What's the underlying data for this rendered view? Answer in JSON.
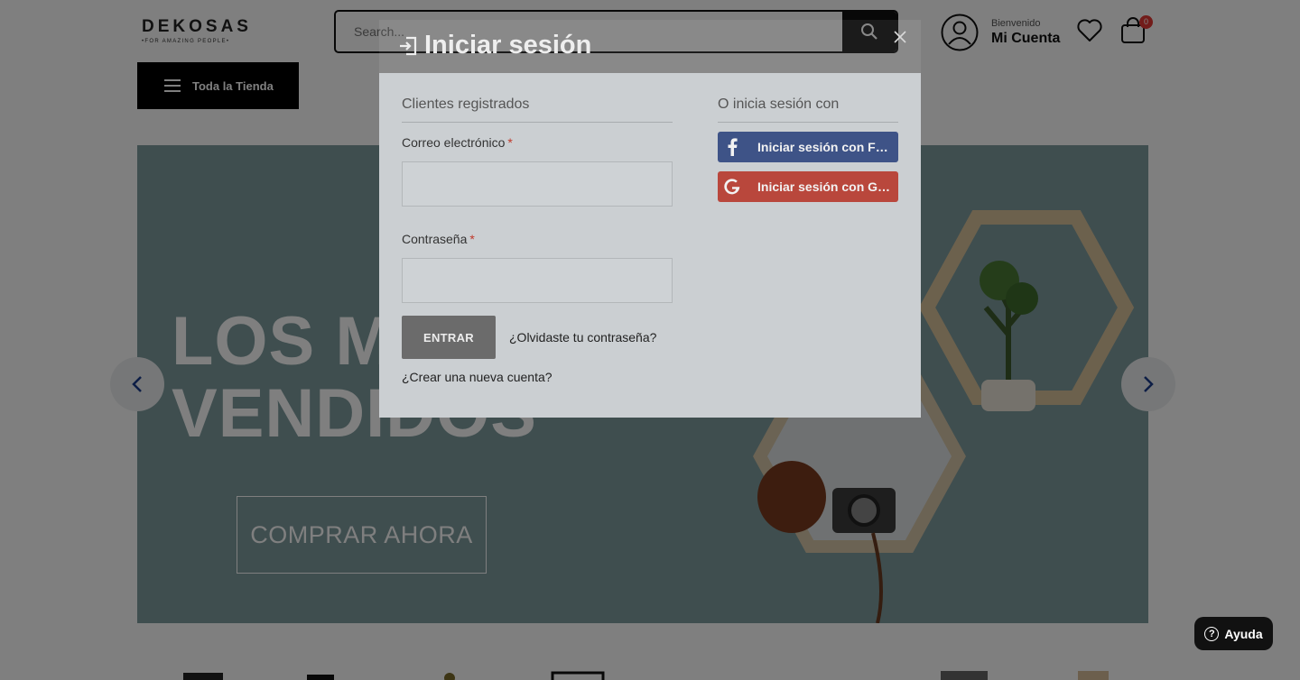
{
  "header": {
    "logo": {
      "name": "DEKOSAS",
      "tagline": "•FOR AMAZING PEOPLE•"
    },
    "search": {
      "placeholder": "Search..."
    },
    "account": {
      "welcome": "Bienvenido",
      "label": "Mi Cuenta"
    },
    "cart": {
      "count": "0"
    },
    "menu_button": "Toda la Tienda"
  },
  "banner": {
    "title": "LOS MÁS\nVENDIDOS",
    "cta": "COMPRAR AHORA"
  },
  "modal": {
    "title": "Iniciar sesión",
    "registered_heading": "Clientes registrados",
    "email_label": "Correo electrónico",
    "password_label": "Contraseña",
    "required_mark": "*",
    "login_button": "ENTRAR",
    "forgot_link": "¿Olvidaste tu contraseña?",
    "create_link": "¿Crear una nueva cuenta?",
    "social_heading": "O inicia sesión con",
    "social_buttons": [
      {
        "provider": "facebook",
        "label": "Iniciar sesión con Facebook",
        "icon": "facebook-icon"
      },
      {
        "provider": "google",
        "label": "Iniciar sesión con Google",
        "icon": "google-icon"
      }
    ]
  },
  "help": {
    "label": "Ayuda"
  },
  "colors": {
    "facebook": "#3e5387",
    "google": "#b9473c",
    "banner_bg": "#7e9c9f",
    "cart_badge": "#e53935"
  }
}
